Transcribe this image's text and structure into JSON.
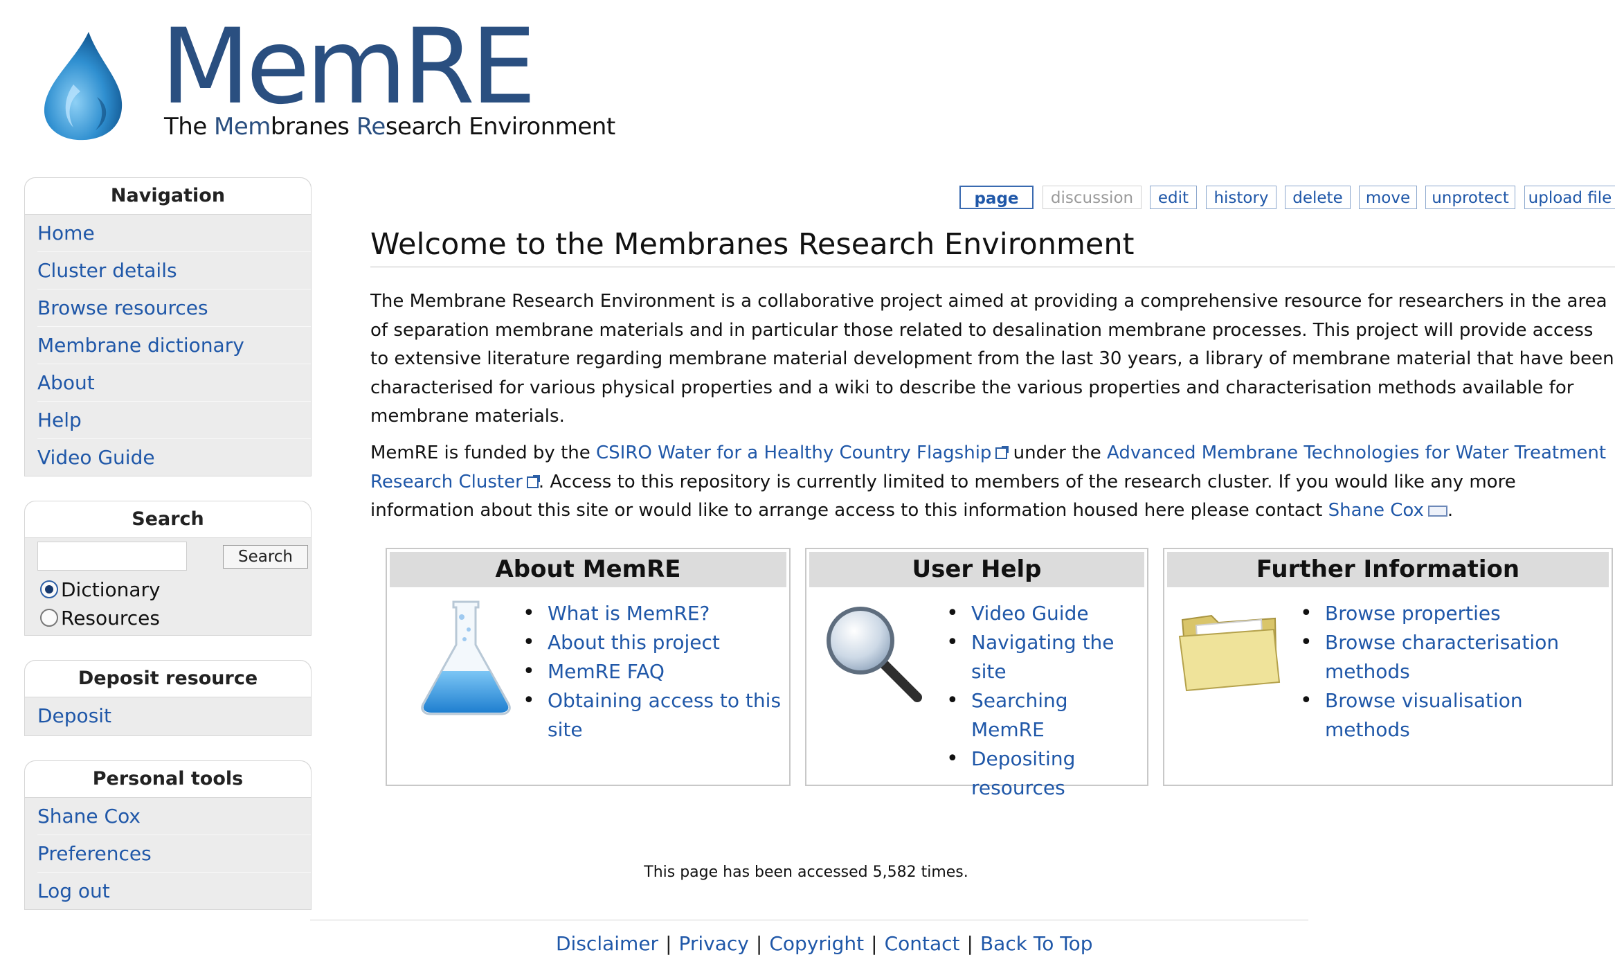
{
  "logo": {
    "wordmark": "MemRE",
    "tagline_parts": [
      "The ",
      "Mem",
      "branes ",
      "Re",
      "search ",
      "Environment"
    ]
  },
  "sidebar": {
    "navigation": {
      "title": "Navigation",
      "items": [
        "Home",
        "Cluster details",
        "Browse resources",
        "Membrane dictionary",
        "About",
        "Help",
        "Video Guide"
      ]
    },
    "search": {
      "title": "Search",
      "input_value": "",
      "button_label": "Search",
      "options": [
        {
          "label": "Dictionary",
          "selected": true
        },
        {
          "label": "Resources",
          "selected": false
        }
      ]
    },
    "deposit": {
      "title": "Deposit resource",
      "items": [
        "Deposit"
      ]
    },
    "personal": {
      "title": "Personal tools",
      "items": [
        "Shane Cox",
        "Preferences",
        "Log out"
      ]
    }
  },
  "tabs": [
    "page",
    "discussion",
    "edit",
    "history",
    "delete",
    "move",
    "unprotect",
    "upload file"
  ],
  "content": {
    "title": "Welcome to the Membranes Research Environment",
    "para1_lines": [
      "The Membrane Research Environment is a collaborative project aimed at providing a comprehensive resource for researchers in the area",
      "of separation membrane materials and in particular those related to desalination membrane processes. This project will provide access",
      "to extensive literature regarding membrane material development from the last 30 years, a library of membrane material that have been",
      "characterised for various physical properties and a wiki to describe the various properties and characterisation methods available for",
      "membrane materials."
    ],
    "para2": {
      "t1": "MemRE is funded by the ",
      "link1": "CSIRO Water for a Healthy Country Flagship",
      "t2": " under the ",
      "link2a": "Advanced Membrane Technologies for Water Treatment",
      "link2b": "Research Cluster",
      "t3": ". Access to this repository is currently limited to members of the research cluster. If you would like any more",
      "t4": "information about this site or would like to arrange access to this information housed here please contact ",
      "link3": "Shane Cox",
      "t5": "."
    }
  },
  "boxes": {
    "about": {
      "title": "About MemRE",
      "links": [
        "What is MemRE?",
        "About this project",
        "MemRE FAQ",
        "Obtaining access to this site"
      ]
    },
    "help": {
      "title": "User Help",
      "links": [
        "Video Guide",
        "Navigating the site",
        "Searching MemRE",
        "Depositing resources"
      ]
    },
    "further": {
      "title": "Further Information",
      "links": [
        "Browse properties",
        "Browse characterisation methods",
        "Browse visualisation methods"
      ]
    }
  },
  "footer": {
    "access_text": "This page has been accessed 5,582 times.",
    "links": [
      "Disclaimer",
      "Privacy",
      "Copyright",
      "Contact",
      "Back To Top"
    ]
  },
  "colors": {
    "link": "#1f57a8",
    "logo_blue": "#2a4f80",
    "sidebar_bg": "#ececec",
    "box_header_bg": "#dcdcdc"
  },
  "icons": [
    "water-drop-logo-icon",
    "external-link-icon",
    "mail-icon",
    "flask-icon",
    "magnifier-icon",
    "folder-icon"
  ]
}
